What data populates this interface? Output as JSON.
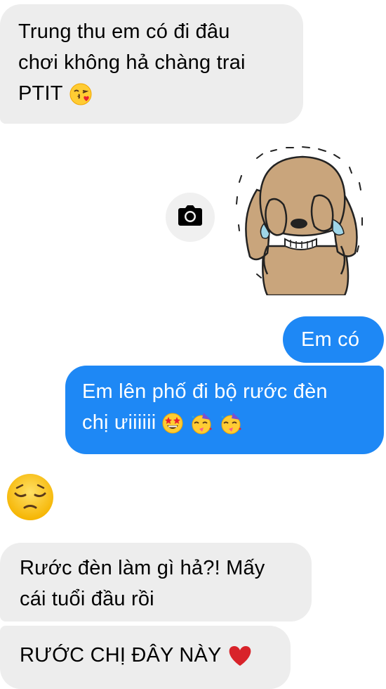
{
  "messages": [
    {
      "sender": "them",
      "lines": [
        "Trung thu em có đi đâu",
        "chơi không hả chàng trai",
        "PTIT"
      ],
      "emoji": "face-blowing-kiss"
    },
    {
      "sender": "me",
      "type": "sticker",
      "sticker": "crying-dog-sticker"
    },
    {
      "sender": "me",
      "lines": [
        "Em có"
      ]
    },
    {
      "sender": "me",
      "lines": [
        "Em lên phố đi bộ rước đèn",
        "chị ưiiiiii"
      ],
      "emoji": [
        "star-struck",
        "partying-face",
        "partying-face"
      ]
    },
    {
      "sender": "them",
      "type": "emoji",
      "emoji": "pensive-face"
    },
    {
      "sender": "them",
      "lines": [
        "Rước đèn làm gì hả?! Mấy",
        "cái tuổi đầu rồi"
      ]
    },
    {
      "sender": "them",
      "lines": [
        "RƯỚC CHỊ ĐÂY NÀY"
      ],
      "emoji": "red-heart"
    }
  ],
  "camera_button": {
    "icon": "camera-icon"
  },
  "colors": {
    "incoming_bubble": "#ededed",
    "outgoing_bubble": "#1e88f5",
    "incoming_text": "#000000",
    "outgoing_text": "#ffffff"
  }
}
